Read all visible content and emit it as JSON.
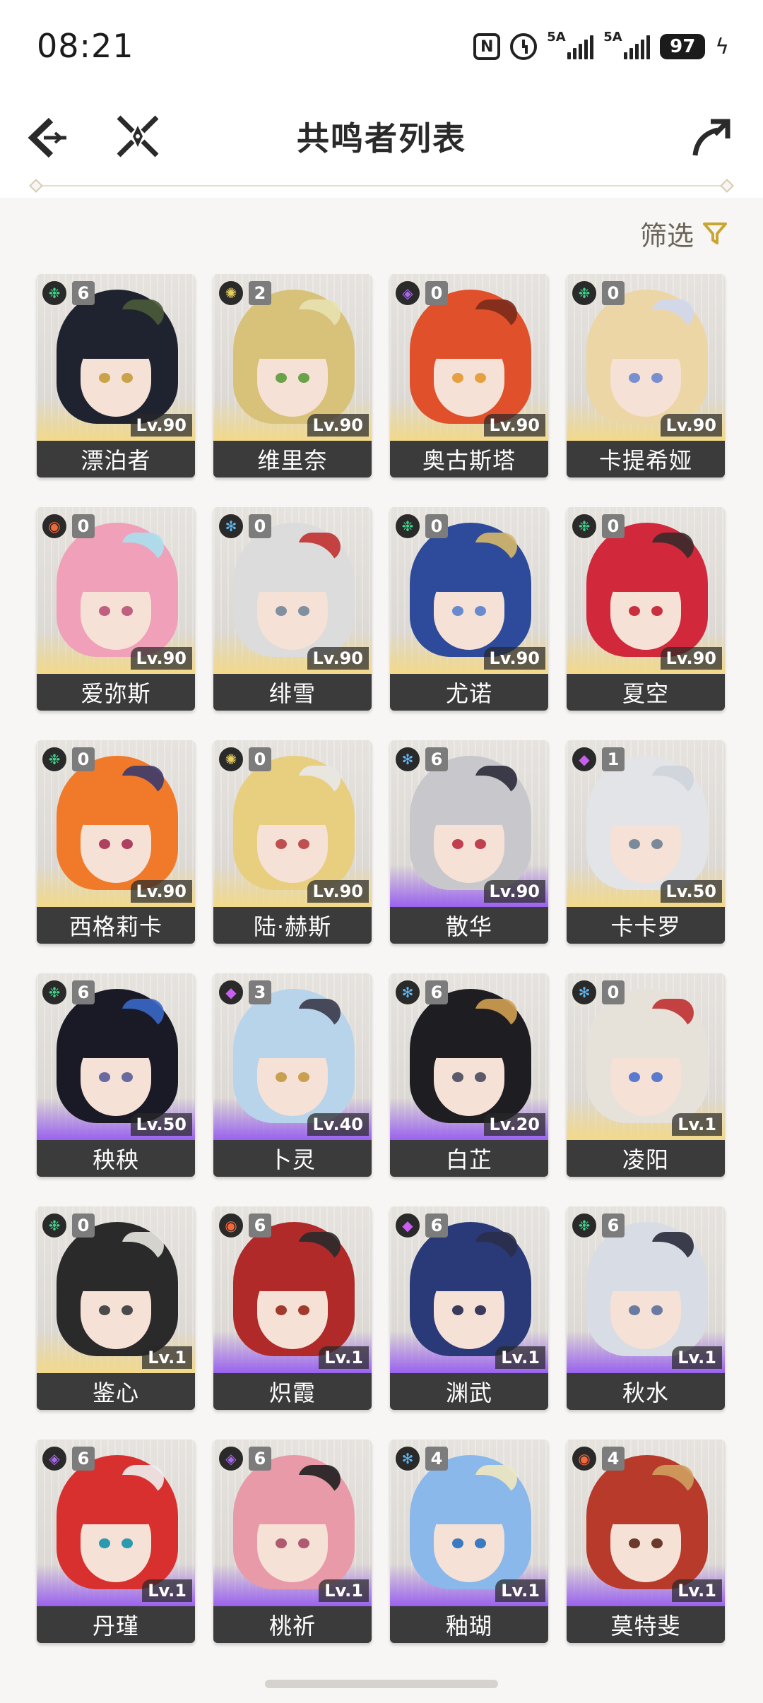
{
  "status_bar": {
    "time": "08:21",
    "nfc": "N",
    "network_1": "5A",
    "network_2": "5A",
    "battery": "97"
  },
  "header": {
    "title": "共鸣者列表"
  },
  "filter": {
    "label": "筛选"
  },
  "element_colors": {
    "aero": "#3fd48a",
    "spectro": "#e7cf5c",
    "havoc": "#a869e8",
    "glacio": "#5fb6f2",
    "fusion": "#f2683b",
    "electro": "#c85ff0"
  },
  "characters": [
    {
      "name": "漂泊者",
      "level": "Lv.90",
      "sequence": "6",
      "element": "aero",
      "element_icon": "aero-icon",
      "rarity": 5,
      "hair": "#1f2330",
      "eye": "#c9a24a",
      "accent": "#4a5a3a"
    },
    {
      "name": "维里奈",
      "level": "Lv.90",
      "sequence": "2",
      "element": "spectro",
      "element_icon": "spectro-icon",
      "rarity": 5,
      "hair": "#d8c27a",
      "eye": "#6aa24a",
      "accent": "#e8e2b0"
    },
    {
      "name": "奥古斯塔",
      "level": "Lv.90",
      "sequence": "0",
      "element": "havoc",
      "element_icon": "havoc-icon",
      "rarity": 5,
      "hair": "#e0502a",
      "eye": "#e6a040",
      "accent": "#7a2a1a"
    },
    {
      "name": "卡提希娅",
      "level": "Lv.90",
      "sequence": "0",
      "element": "aero",
      "element_icon": "aero-icon",
      "rarity": 5,
      "hair": "#ecd6a6",
      "eye": "#7a8fcf",
      "accent": "#cfd8ef"
    },
    {
      "name": "爱弥斯",
      "level": "Lv.90",
      "sequence": "0",
      "element": "fusion",
      "element_icon": "fusion-icon",
      "rarity": 5,
      "hair": "#f0a0b8",
      "eye": "#c06080",
      "accent": "#a8e0f0"
    },
    {
      "name": "绯雪",
      "level": "Lv.90",
      "sequence": "0",
      "element": "glacio",
      "element_icon": "glacio-icon",
      "rarity": 5,
      "hair": "#dcdcdc",
      "eye": "#8090a0",
      "accent": "#c03030"
    },
    {
      "name": "尤诺",
      "level": "Lv.90",
      "sequence": "0",
      "element": "aero",
      "element_icon": "aero-icon",
      "rarity": 5,
      "hair": "#2e4a9a",
      "eye": "#6a8ad0",
      "accent": "#d6b86a"
    },
    {
      "name": "夏空",
      "level": "Lv.90",
      "sequence": "0",
      "element": "aero",
      "element_icon": "aero-icon",
      "rarity": 5,
      "hair": "#d2283c",
      "eye": "#c83040",
      "accent": "#3a2a2a"
    },
    {
      "name": "西格莉卡",
      "level": "Lv.90",
      "sequence": "0",
      "element": "aero",
      "element_icon": "aero-icon",
      "rarity": 5,
      "hair": "#f07a2a",
      "eye": "#b04060",
      "accent": "#3a3a6a"
    },
    {
      "name": "陆·赫斯",
      "level": "Lv.90",
      "sequence": "0",
      "element": "spectro",
      "element_icon": "spectro-icon",
      "rarity": 5,
      "hair": "#e8cf80",
      "eye": "#c05050",
      "accent": "#e8e8e8"
    },
    {
      "name": "散华",
      "level": "Lv.90",
      "sequence": "6",
      "element": "glacio",
      "element_icon": "glacio-icon",
      "rarity": 4,
      "hair": "#c8c8cc",
      "eye": "#c04050",
      "accent": "#2a2a3a"
    },
    {
      "name": "卡卡罗",
      "level": "Lv.50",
      "sequence": "1",
      "element": "electro",
      "element_icon": "electro-icon",
      "rarity": 5,
      "hair": "#e2e4e8",
      "eye": "#7a8a9a",
      "accent": "#cfd3da"
    },
    {
      "name": "秧秧",
      "level": "Lv.50",
      "sequence": "6",
      "element": "aero",
      "element_icon": "aero-icon",
      "rarity": 4,
      "hair": "#1a1a26",
      "eye": "#6a6aa0",
      "accent": "#3a68c8"
    },
    {
      "name": "卜灵",
      "level": "Lv.40",
      "sequence": "3",
      "element": "electro",
      "element_icon": "electro-icon",
      "rarity": 4,
      "hair": "#b8d4ea",
      "eye": "#c8a050",
      "accent": "#3a3a4a"
    },
    {
      "name": "白芷",
      "level": "Lv.20",
      "sequence": "6",
      "element": "glacio",
      "element_icon": "glacio-icon",
      "rarity": 4,
      "hair": "#1e1e22",
      "eye": "#5a5a6a",
      "accent": "#d0a050"
    },
    {
      "name": "凌阳",
      "level": "Lv.1",
      "sequence": "0",
      "element": "glacio",
      "element_icon": "glacio-icon",
      "rarity": 5,
      "hair": "#e6e2da",
      "eye": "#5a7ad0",
      "accent": "#c03030"
    },
    {
      "name": "鉴心",
      "level": "Lv.1",
      "sequence": "0",
      "element": "aero",
      "element_icon": "aero-icon",
      "rarity": 5,
      "hair": "#2a2a2a",
      "eye": "#4a4a4a",
      "accent": "#e8e6e0"
    },
    {
      "name": "炽霞",
      "level": "Lv.1",
      "sequence": "6",
      "element": "fusion",
      "element_icon": "fusion-icon",
      "rarity": 4,
      "hair": "#b02a2a",
      "eye": "#a03a2a",
      "accent": "#2a2a2a"
    },
    {
      "name": "渊武",
      "level": "Lv.1",
      "sequence": "6",
      "element": "electro",
      "element_icon": "electro-icon",
      "rarity": 4,
      "hair": "#2a3a78",
      "eye": "#3a3a5a",
      "accent": "#2a2e4a"
    },
    {
      "name": "秋水",
      "level": "Lv.1",
      "sequence": "6",
      "element": "aero",
      "element_icon": "aero-icon",
      "rarity": 4,
      "hair": "#d8dce4",
      "eye": "#6a7aa0",
      "accent": "#2a2a3a"
    },
    {
      "name": "丹瑾",
      "level": "Lv.1",
      "sequence": "6",
      "element": "havoc",
      "element_icon": "havoc-icon",
      "rarity": 4,
      "hair": "#d8302e",
      "eye": "#2a9ab0",
      "accent": "#f0f0f0"
    },
    {
      "name": "桃祈",
      "level": "Lv.1",
      "sequence": "6",
      "element": "havoc",
      "element_icon": "havoc-icon",
      "rarity": 4,
      "hair": "#e89aa8",
      "eye": "#b05a70",
      "accent": "#1e1e1e"
    },
    {
      "name": "釉瑚",
      "level": "Lv.1",
      "sequence": "4",
      "element": "glacio",
      "element_icon": "glacio-icon",
      "rarity": 4,
      "hair": "#8ab8ea",
      "eye": "#3a7ac0",
      "accent": "#f0e8c0"
    },
    {
      "name": "莫特斐",
      "level": "Lv.1",
      "sequence": "4",
      "element": "fusion",
      "element_icon": "fusion-icon",
      "rarity": 4,
      "hair": "#b83a2a",
      "eye": "#6a3a2a",
      "accent": "#d0a060"
    }
  ],
  "icons": {
    "back": "back-arrow-icon",
    "compress": "collapse-icon",
    "share": "share-icon",
    "filter": "filter-funnel-icon"
  }
}
